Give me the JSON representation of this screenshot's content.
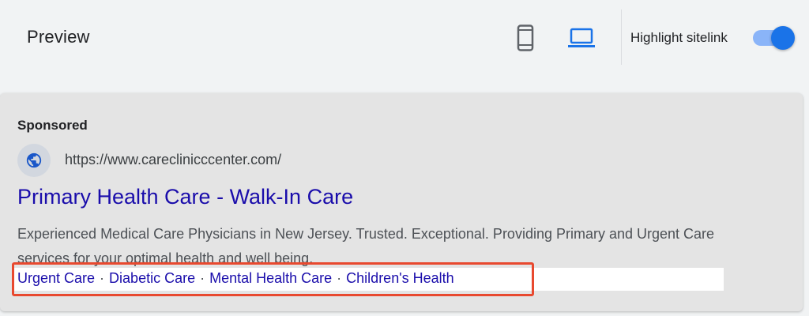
{
  "header": {
    "title": "Preview",
    "toggle_label": "Highlight sitelink",
    "toggle_on": true,
    "icons": {
      "mobile": "smartphone-icon",
      "desktop": "laptop-icon"
    },
    "active_view": "desktop"
  },
  "ad": {
    "sponsored_label": "Sponsored",
    "favicon": "globe-icon",
    "url": "https://www.careclinicccenter.com/",
    "headline": "Primary Health Care - Walk-In Care",
    "description": "Experienced Medical Care Physicians in New Jersey. Trusted. Exceptional. Providing Primary and Urgent Care services for your optimal health and well being.",
    "sitelinks": [
      "Urgent Care",
      "Diabetic Care",
      "Mental Health Care",
      "Children's Health"
    ],
    "separator": "·"
  },
  "colors": {
    "accent": "#1a73e8",
    "link": "#1a0dab",
    "highlight": "#e8492f"
  }
}
